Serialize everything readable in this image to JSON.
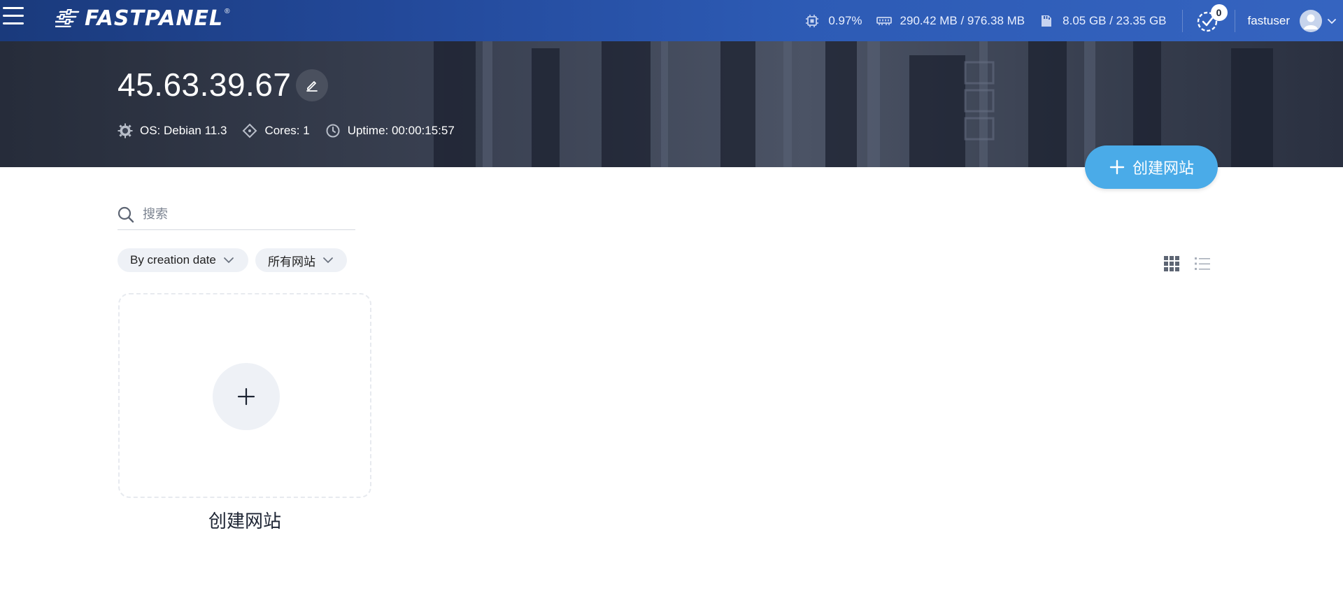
{
  "header": {
    "logo_text": "FASTPANEL",
    "logo_reg": "®",
    "cpu": "0.97%",
    "ram": "290.42 MB / 976.38 MB",
    "disk": "8.05 GB / 23.35 GB",
    "tasks_count": "0",
    "username": "fastuser"
  },
  "server": {
    "ip": "45.63.39.67",
    "os": "OS: Debian 11.3",
    "cores": "Cores: 1",
    "uptime": "Uptime: 00:00:15:57"
  },
  "actions": {
    "create_site_label": "创建网站"
  },
  "search": {
    "placeholder": "搜索"
  },
  "filters": {
    "sort_label": "By creation date",
    "type_label": "所有网站"
  },
  "card": {
    "plus": "+",
    "label": "创建网站"
  },
  "colors": {
    "header_start": "#1a3a7c",
    "header_end": "#3564c0",
    "accent": "#4aabe8",
    "chip_bg": "#eef1f6"
  }
}
